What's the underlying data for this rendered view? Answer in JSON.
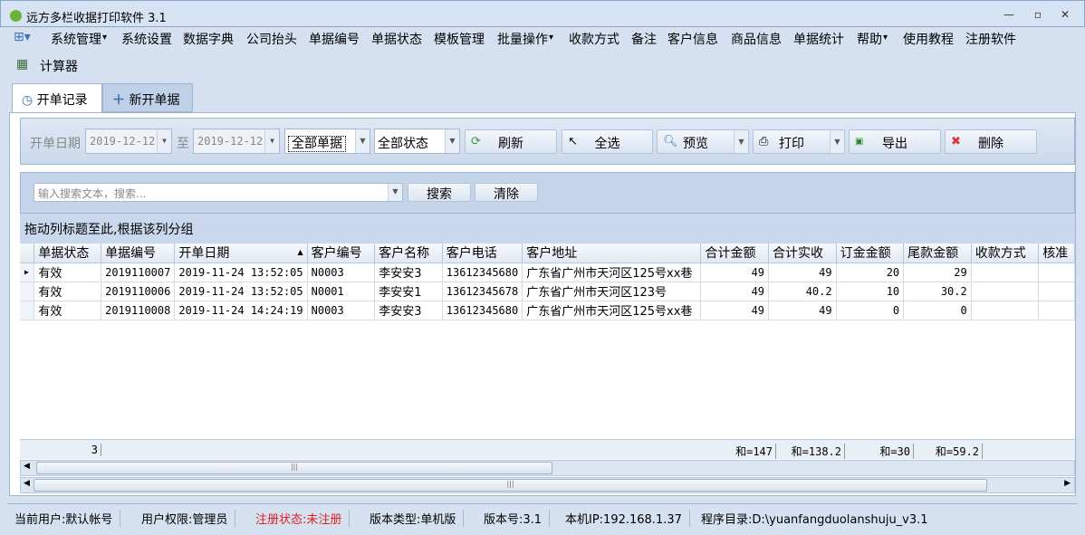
{
  "window": {
    "title": "远方多栏收据打印软件 3.1"
  },
  "menu": {
    "items": [
      "系统管理",
      "系统设置",
      "数据字典",
      "公司抬头",
      "单据编号",
      "单据状态",
      "模板管理",
      "批量操作",
      "收款方式",
      "备注",
      "客户信息",
      "商品信息",
      "单据统计",
      "帮助",
      "使用教程",
      "注册软件"
    ],
    "calculator": "计算器"
  },
  "tabs": [
    {
      "label": "开单记录",
      "icon": "history-icon"
    },
    {
      "label": "新开单据",
      "icon": "plus-icon"
    }
  ],
  "filter": {
    "date_label": "开单日期",
    "date_from": "2019-12-12",
    "to_label": "至",
    "date_to": "2019-12-12",
    "type_value": "全部单据",
    "status_value": "全部状态",
    "buttons": {
      "refresh": "刷新",
      "select_all": "全选",
      "preview": "预览",
      "print": "打印",
      "export": "导出",
      "delete": "删除"
    }
  },
  "search": {
    "placeholder": "输入搜索文本，搜索...",
    "search_label": "搜索",
    "clear_label": "清除"
  },
  "group_hint": "拖动列标题至此,根据该列分组",
  "table": {
    "columns": [
      "单据状态",
      "单据编号",
      "开单日期",
      "客户编号",
      "客户名称",
      "客户电话",
      "客户地址",
      "合计金额",
      "合计实收",
      "订金金额",
      "尾款金额",
      "收款方式",
      "核准"
    ],
    "rows": [
      [
        "有效",
        "2019110007",
        "2019-11-24 13:52:05",
        "N0003",
        "李安安3",
        "13612345680",
        "广东省广州市天河区125号xx巷",
        "49",
        "49",
        "20",
        "29",
        "",
        ""
      ],
      [
        "有效",
        "2019110006",
        "2019-11-24 13:52:05",
        "N0001",
        "李安安1",
        "13612345678",
        "广东省广州市天河区123号",
        "49",
        "40.2",
        "10",
        "30.2",
        "",
        ""
      ],
      [
        "有效",
        "2019110008",
        "2019-11-24 14:24:19",
        "N0003",
        "李安安3",
        "13612345680",
        "广东省广州市天河区125号xx巷",
        "49",
        "49",
        "0",
        "0",
        "",
        ""
      ]
    ],
    "footer": {
      "count": "3",
      "sum_total": "和=147",
      "sum_received": "和=138.2",
      "sum_deposit": "和=30",
      "sum_balance": "和=59.2"
    }
  },
  "status": {
    "user": "当前用户:默认帐号",
    "role": "用户权限:管理员",
    "reg": "注册状态:未注册",
    "edition": "版本类型:单机版",
    "version": "版本号:3.1",
    "ip": "本机IP:192.168.1.37",
    "dir": "程序目录:D:\\yuanfangduolanshuju_v3.1"
  },
  "colors": {
    "accent": "#d5e1f1",
    "warning": "#e02020"
  }
}
